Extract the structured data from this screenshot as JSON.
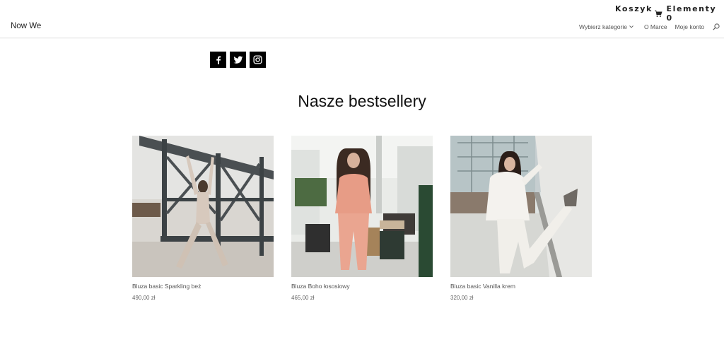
{
  "topbar": {
    "cart_label": "Koszyk",
    "items_label": "Elementy 0",
    "cart_icon": "shopping-cart-icon"
  },
  "header": {
    "logo": "Now We",
    "nav": {
      "categories_label": "Wybierz kategorie",
      "about_label": "O Marce",
      "account_label": "Moje konto"
    },
    "search_icon": "search-icon"
  },
  "social": {
    "icons": [
      "facebook-icon",
      "twitter-icon",
      "instagram-icon"
    ]
  },
  "section": {
    "title": "Nasze bestsellery"
  },
  "products": [
    {
      "name": "Bluza basic Sparkling beż",
      "price": "490,00 zł"
    },
    {
      "name": "Bluza Boho łososiowy",
      "price": "465,00 zł"
    },
    {
      "name": "Bluza basic Vanilla krem",
      "price": "320,00 zł"
    }
  ],
  "colors": {
    "text": "#333333",
    "social_bg": "#000000",
    "background": "#ffffff"
  }
}
